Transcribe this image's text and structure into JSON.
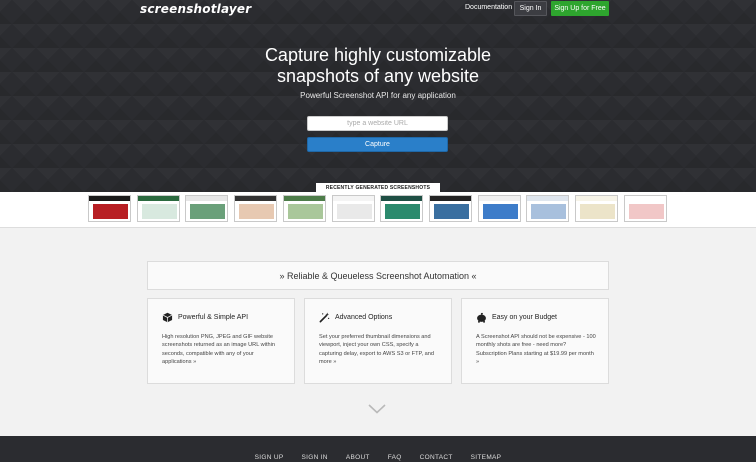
{
  "header": {
    "logo": "screenshotlayer",
    "nav_documentation": "Documentation",
    "sign_in": "Sign In",
    "sign_up": "Sign Up for Free"
  },
  "hero": {
    "headline_line1": "Capture highly customizable",
    "headline_line2": "snapshots of any website",
    "subheadline": "Powerful Screenshot API for any application",
    "url_placeholder": "type a website URL",
    "capture_button": "Capture",
    "recent_label": "RECENTLY GENERATED SCREENSHOTS"
  },
  "thumbnails": [
    {
      "bar": "#1a1a1a",
      "content": "#b81f24"
    },
    {
      "bar": "#2b6a3f",
      "content": "#d8e9df"
    },
    {
      "bar": "#e6e6e6",
      "content": "#6aa07a"
    },
    {
      "bar": "#333333",
      "content": "#e7c9b2"
    },
    {
      "bar": "#4e7d4a",
      "content": "#a9c79a"
    },
    {
      "bar": "#f4f4f4",
      "content": "#e9e9e9"
    },
    {
      "bar": "#1e4f44",
      "content": "#2b8a6d"
    },
    {
      "bar": "#232323",
      "content": "#3a6fa0"
    },
    {
      "bar": "#f0f0f0",
      "content": "#3d7cc9"
    },
    {
      "bar": "#dfe6ee",
      "content": "#a8c0dd"
    },
    {
      "bar": "#f7f4e8",
      "content": "#ece4c9"
    },
    {
      "bar": "#ffffff",
      "content": "#f1c7c7"
    }
  ],
  "main": {
    "section_title": "» Reliable & Queueless Screenshot Automation «",
    "features": [
      {
        "icon": "cube-icon",
        "title": "Powerful & Simple API",
        "description": "High resolution PNG, JPEG and GIF website screenshots returned as an image URL within seconds, compatible with any of your applications »"
      },
      {
        "icon": "magic-wand-icon",
        "title": "Advanced Options",
        "description": "Set your preferred thumbnail dimensions and viewport, inject your own CSS, specify a capturing delay, export to AWS S3 or FTP, and more »"
      },
      {
        "icon": "piggy-bank-icon",
        "title": "Easy on your Budget",
        "description": "A Screenshot API should not be expensive - 100 monthly shots are free - need more? Subscription Plans starting at $19.99 per month »"
      }
    ]
  },
  "footer": {
    "links": [
      "SIGN UP",
      "SIGN IN",
      "ABOUT",
      "FAQ",
      "CONTACT",
      "SITEMAP"
    ]
  },
  "colors": {
    "hero_bg": "#2b2c30",
    "signup_green": "#2ea52e",
    "capture_blue": "#2a7fc9"
  }
}
